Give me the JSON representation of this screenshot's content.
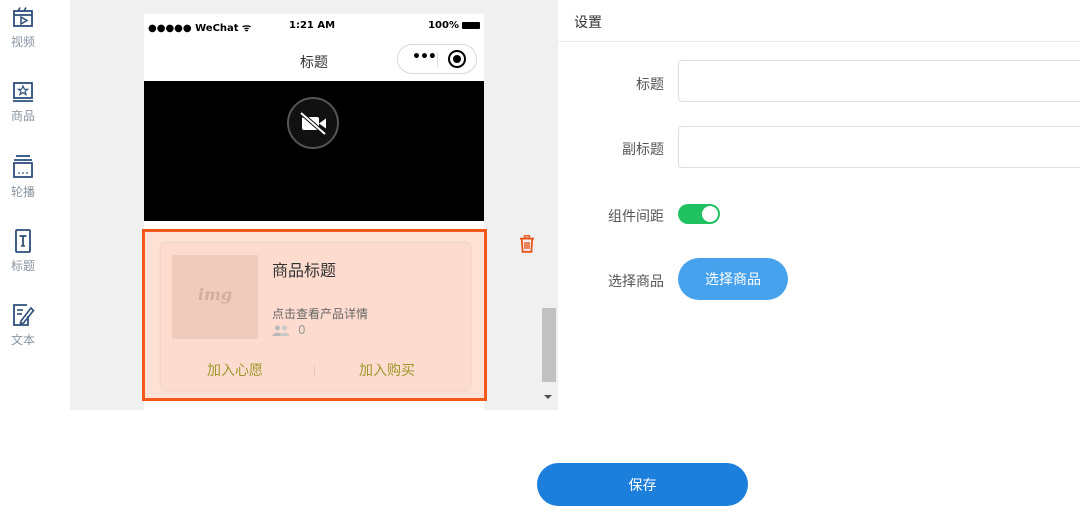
{
  "sidebar": {
    "items": [
      {
        "label": "视频",
        "icon": "video-icon"
      },
      {
        "label": "商品",
        "icon": "product-icon"
      },
      {
        "label": "轮播",
        "icon": "carousel-icon"
      },
      {
        "label": "标题",
        "icon": "title-icon"
      },
      {
        "label": "文本",
        "icon": "text-icon"
      }
    ]
  },
  "phone": {
    "status": {
      "carrier": "●●●●● WeChat ᯤ",
      "time": "1:21 AM",
      "battery": "100%"
    },
    "nav_title": "标题",
    "capsule_more": "•••"
  },
  "product_card": {
    "image_placeholder": "img",
    "title": "商品标题",
    "description": "点击查看产品详情",
    "count": "0",
    "wish_label": "加入心愿",
    "buy_label": "加入购买"
  },
  "settings": {
    "header": "设置",
    "title_label": "标题",
    "title_value": "",
    "subtitle_label": "副标题",
    "subtitle_value": "",
    "spacing_label": "组件间距",
    "spacing_on": true,
    "select_label": "选择商品",
    "select_button": "选择商品"
  },
  "save_label": "保存",
  "colors": {
    "accent_blue": "#1c7fdc",
    "button_blue": "#47a2ee",
    "toggle_green": "#20c161",
    "selection_orange": "#f4581b",
    "delete_red": "#e8561c",
    "action_olive": "#a0982c"
  }
}
